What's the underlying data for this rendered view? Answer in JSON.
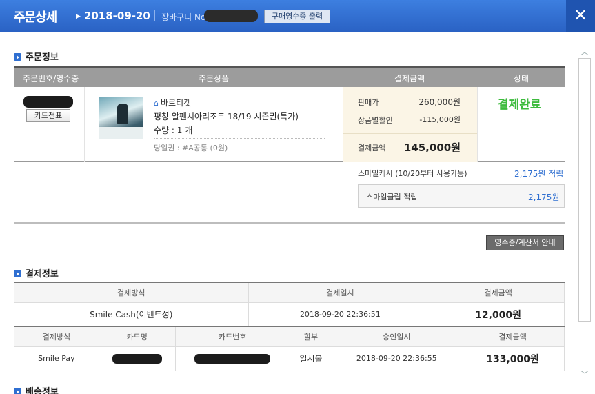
{
  "header": {
    "title": "주문상세",
    "date": "2018-09-20",
    "cart_label": "장바구니 No",
    "receipt_button": "구매영수증 출력",
    "close_icon": "✕"
  },
  "order_section": {
    "title": "주문정보",
    "columns": [
      "주문번호/영수증",
      "주문상품",
      "결제금액",
      "상태"
    ],
    "card_slip_button": "카드전표",
    "shop_name": "바로티켓",
    "product_name": "평창 알펜시아리조트 18/19 시즌권(특가)",
    "quantity": "수량 : 1 개",
    "voucher": "당일권 : #A공통 (0원)",
    "sale_price_label": "판매가",
    "sale_price": "260,000원",
    "discount_label": "상품별할인",
    "discount": "-115,000원",
    "pay_amount_label": "결제금액",
    "pay_amount": "145,000원",
    "status": "결제완료"
  },
  "rewards": {
    "smile_cash_label": "스마일캐시 (10/20부터 사용가능)",
    "smile_cash_value": "2,175원 적립",
    "smile_club_label": "스마일클럽 적립",
    "smile_club_value": "2,175원"
  },
  "guide_button": "영수증/계산서 안내",
  "payment_section": {
    "title": "결제정보",
    "table1": {
      "headers": [
        "결제방식",
        "결제일시",
        "결제금액"
      ],
      "row": [
        "Smile Cash(이벤트성)",
        "2018-09-20 22:36:51",
        "12,000원"
      ]
    },
    "table2": {
      "headers": [
        "결제방식",
        "카드명",
        "카드번호",
        "할부",
        "승인일시",
        "결제금액"
      ],
      "row": [
        "Smile Pay",
        "",
        "",
        "일시불",
        "2018-09-20 22:36:55",
        "133,000원"
      ]
    }
  },
  "delivery_section": {
    "title": "배송정보"
  },
  "colors": {
    "header_blue": "#2a62c4",
    "status_green": "#3dbb3d",
    "link_blue": "#2f6fd1"
  }
}
